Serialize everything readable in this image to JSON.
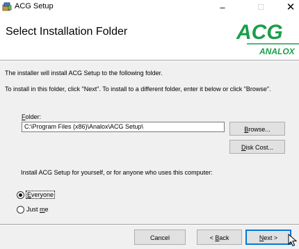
{
  "window": {
    "title": "ACG Setup",
    "minimize_glyph": "–",
    "maximize_glyph": "☐",
    "close_glyph": "✕"
  },
  "header": {
    "title": "Select Installation Folder",
    "logo_text": "ACG",
    "logo_subtext": "ANALOX",
    "logo_color": "#1a9e4b"
  },
  "body": {
    "intro_line1": "The installer will install ACG Setup to the following folder.",
    "intro_line2": "To install in this folder, click \"Next\". To install to a different folder, enter it below or click \"Browse\".",
    "folder": {
      "label_hotkey": "F",
      "label_rest": "older:",
      "value": "C:\\Program Files (x86)\\Analox\\ACG Setup\\"
    },
    "browse_hotkey": "B",
    "browse_rest": "rowse...",
    "diskcost_hotkey": "D",
    "diskcost_rest": "isk Cost...",
    "scope_text": "Install ACG Setup for yourself, or for anyone who uses this computer:",
    "scope_options": {
      "everyone_hotkey": "E",
      "everyone_rest": "veryone",
      "everyone_selected": true,
      "justme_prefix": "Just ",
      "justme_hotkey": "m",
      "justme_rest": "e",
      "justme_selected": false
    }
  },
  "footer": {
    "cancel_label": "Cancel",
    "back_prefix": "< ",
    "back_hotkey": "B",
    "back_rest": "ack",
    "next_hotkey": "N",
    "next_rest": "ext >"
  },
  "icons": [
    "installer-app-icon",
    "mouse-pointer-icon"
  ],
  "colors": {
    "focus_border": "#0078d7",
    "background": "#f0f0f0"
  }
}
